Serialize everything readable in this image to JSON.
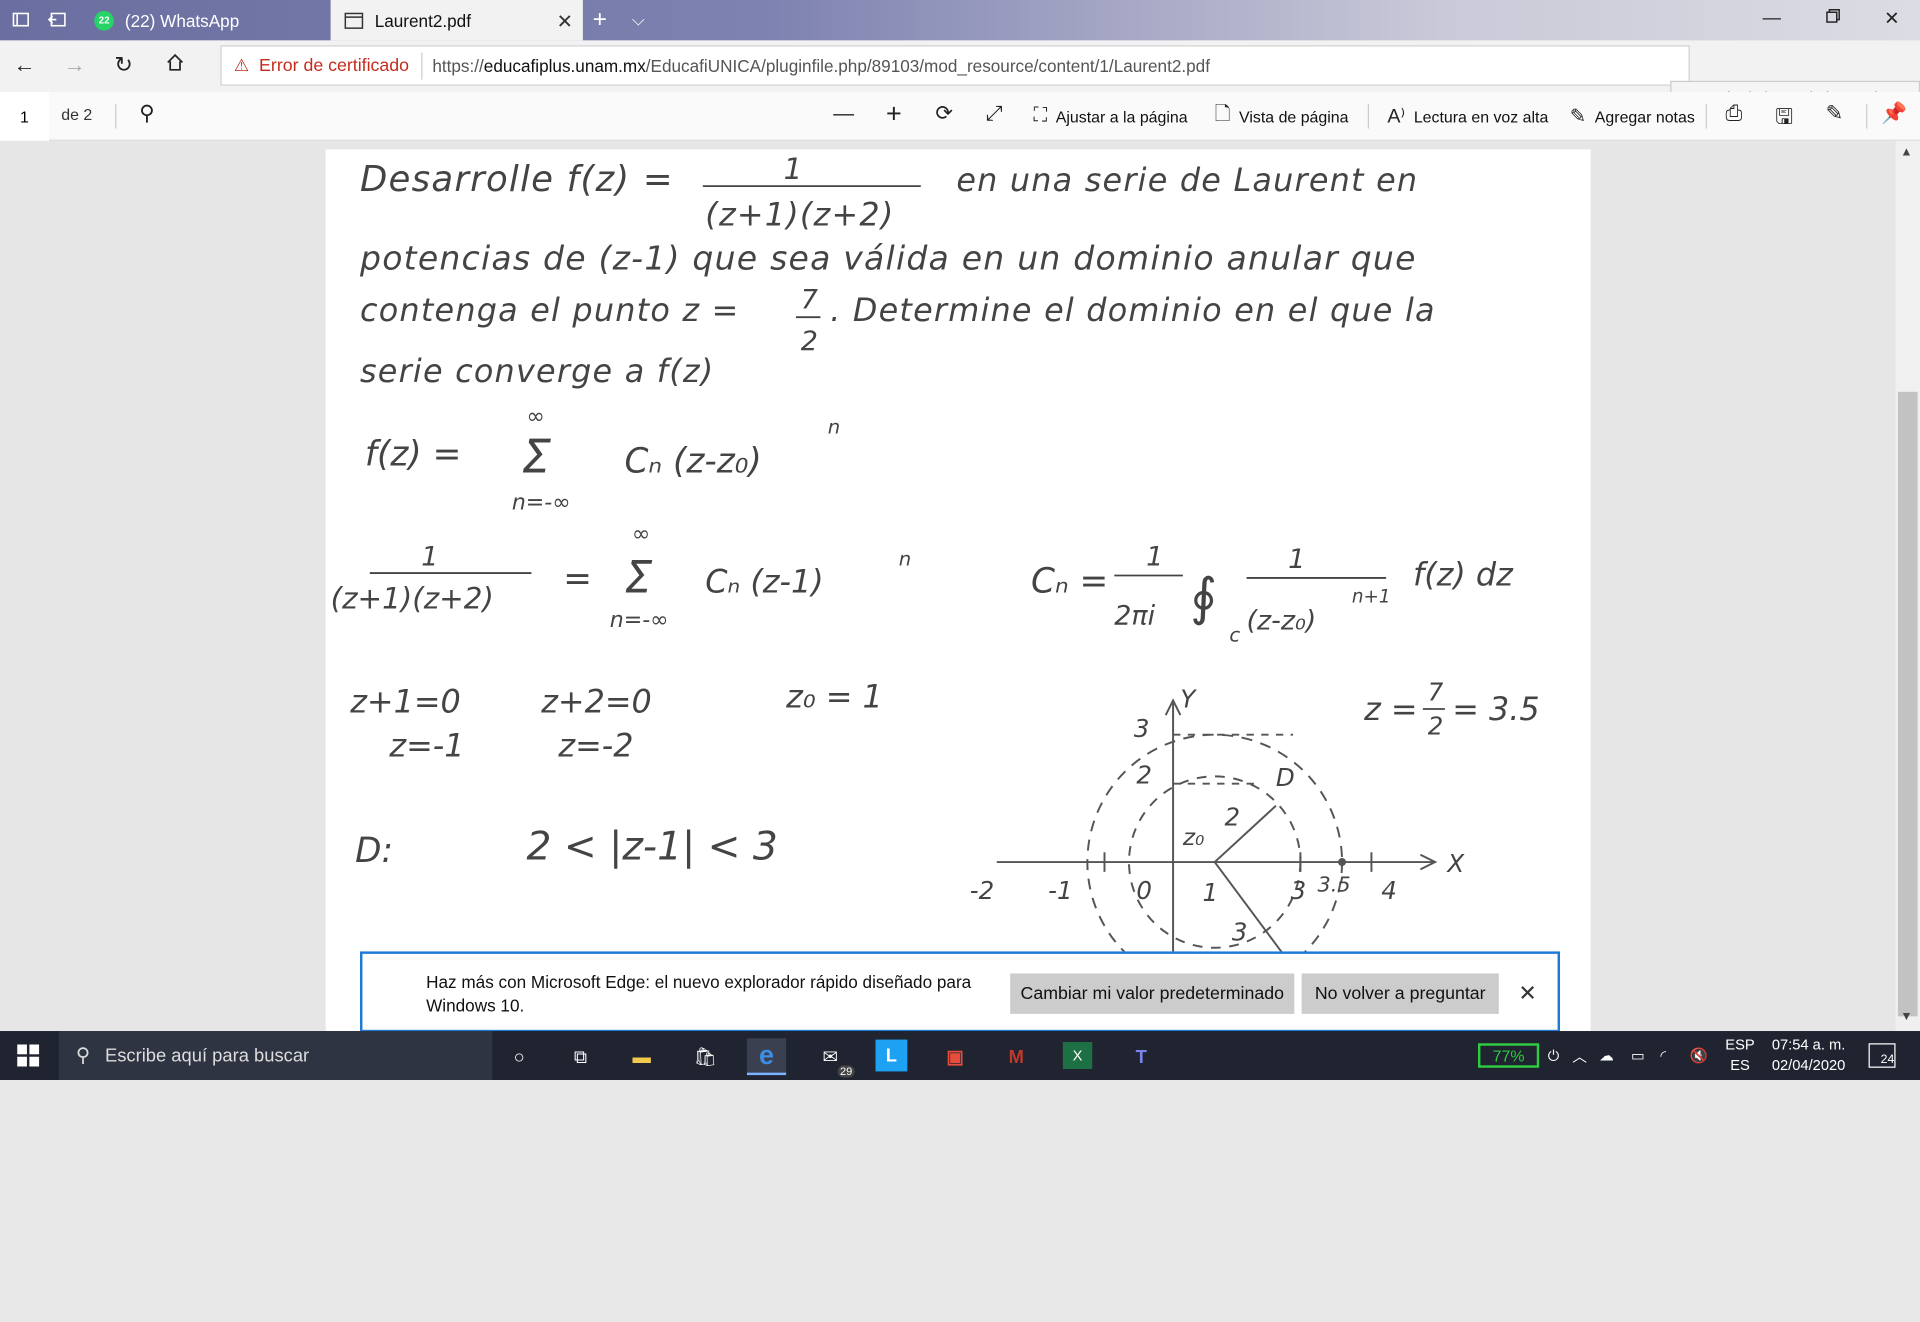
{
  "tabs": {
    "inactive_label": "(22) WhatsApp",
    "whatsapp_badge": "22",
    "active_label": "Laurent2.pdf"
  },
  "address": {
    "cert_error": "Error de certificado",
    "url_prefix": "https://",
    "url_host": "educafiplus.unam.mx",
    "url_path": "/EducafiUNICA/pluginfile.php/89103/mod_resource/content/1/Laurent2.pdf",
    "tooltip": "Desanclar la barra de herramientas"
  },
  "pdf_toolbar": {
    "page": "1",
    "of": "de 2",
    "fit": "Ajustar a la página",
    "view": "Vista de página",
    "read": "Lectura en voz alta",
    "notes": "Agregar notas"
  },
  "notice": {
    "message": "Haz más con Microsoft Edge: el nuevo explorador rápido diseñado para Windows 10.",
    "btn_default": "Cambiar mi valor predeterminado",
    "btn_never": "No volver a preguntar"
  },
  "taskbar": {
    "search_placeholder": "Escribe aquí para buscar",
    "mail_badge": "29",
    "battery": "77%",
    "lang": "ESP",
    "lang2": "ES",
    "time": "07:54 a. m.",
    "date": "02/04/2020",
    "notif_count": "24"
  },
  "document": {
    "line1a": "Desarrolle f(z) =",
    "line1_num": "1",
    "line1_den": "(z+1)(z+2)",
    "line1b": "en una serie de Laurent en",
    "line2": "potencias de (z-1) que sea válida en un dominio anular que",
    "line3a": "contenga el punto z =",
    "line3_frac_num": "7",
    "line3_frac_den": "2",
    "line3b": ". Determine el dominio en el que la",
    "line4": "serie converge a f(z)",
    "eq1_lhs": "f(z) =",
    "eq1_sum": "Σ",
    "eq1_top": "∞",
    "eq1_bot": "n=-∞",
    "eq1_term": "Cₙ (z-z₀)",
    "eq1_exp": "n",
    "eq2_num": "1",
    "eq2_den": "(z+1)(z+2)",
    "eq2_eq": "=",
    "eq2_sum": "Σ",
    "eq2_top": "∞",
    "eq2_bot": "n=-∞",
    "eq2_term": "Cₙ (z-1)",
    "eq2_exp": "n",
    "cn_lhs": "Cₙ =",
    "cn_num": "1",
    "cn_den": "2πi",
    "cn_int": "∮",
    "cn_c": "c",
    "cn_frac_num": "1",
    "cn_frac_den": "(z-z₀)",
    "cn_frac_exp": "n+1",
    "cn_tail": "f(z) dz",
    "root1": "z+1=0",
    "root1b": "z=-1",
    "root2": "z+2=0",
    "root2b": "z=-2",
    "z0": "z₀ = 1",
    "zval_a": "z =",
    "zval_num": "7",
    "zval_den": "2",
    "zval_b": "= 3.5",
    "domain_label": "D:",
    "domain": "2 < |z-1| < 3",
    "plot": {
      "y_axis": "Y",
      "x_axis": "X",
      "region": "D",
      "z0": "z₀",
      "r_inner": "2",
      "r_outer": "3",
      "tick_y3": "3",
      "tick_y2": "2",
      "tick_m2": "-2",
      "tick_m1": "-1",
      "tick_0": "0",
      "tick_1": "1",
      "tick_3": "3",
      "tick_35": "3.5",
      "tick_4": "4"
    }
  }
}
